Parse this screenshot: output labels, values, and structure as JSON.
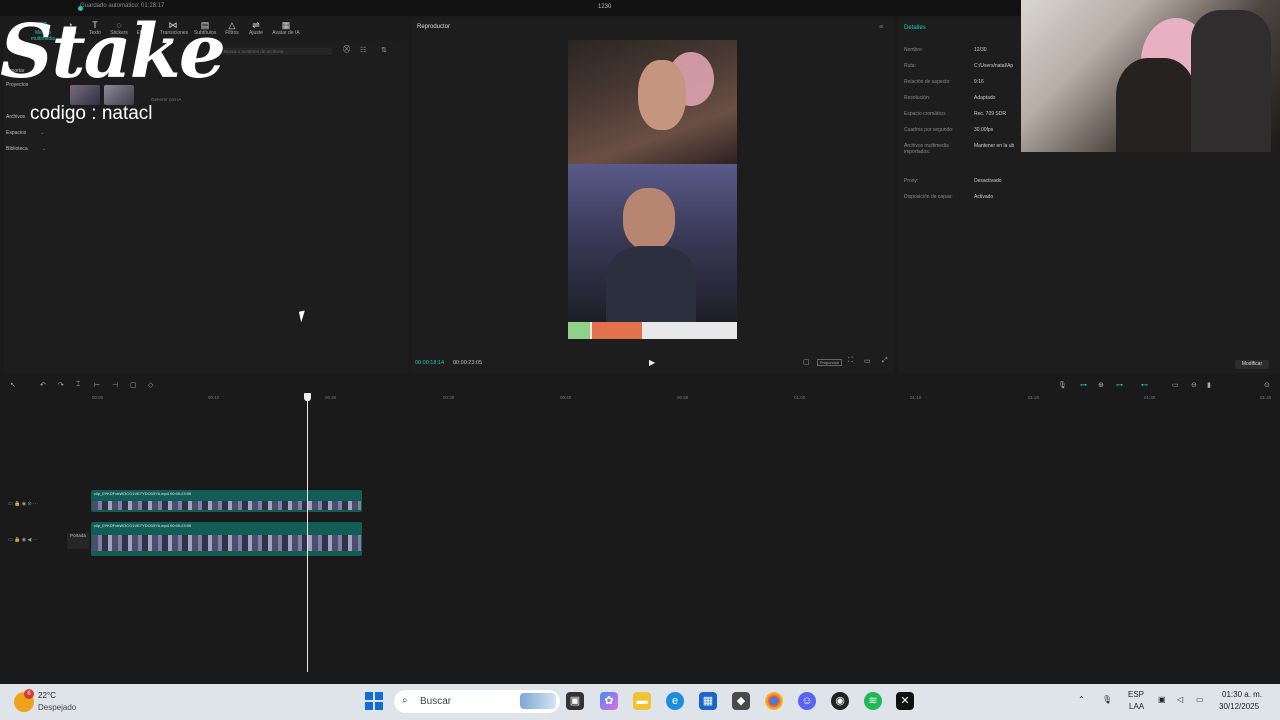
{
  "titlebar": {
    "autosave": "Guardado automático: 01:28:17",
    "project_name": "1230"
  },
  "toolbar": {
    "items": [
      "Medios multimedia",
      "Audio",
      "Texto",
      "Stickers",
      "Efectos",
      "Transiciones",
      "Subtítulos",
      "Filtros",
      "Ajuste",
      "Avatar de IA"
    ]
  },
  "left_panel": {
    "nav": [
      "Importar",
      "Proyectos",
      "Archivos",
      "Espacios",
      "Biblioteca"
    ],
    "search_placeholder": "Busca o nombres de archivos",
    "thumb_caption": "Generar con IA"
  },
  "overlay": {
    "brand": "Stake",
    "code_text": "codigo : natacl"
  },
  "player": {
    "title": "Reproductor",
    "current_time": "00:00:18:14",
    "total_time": "00:00:23:05",
    "ratio_label": "Proporción"
  },
  "details": {
    "title": "Detalles",
    "rows": [
      {
        "label": "Nombre:",
        "value": "12/30"
      },
      {
        "label": "Ruta:",
        "value": "C:/Users/natal/Ap"
      },
      {
        "label": "Relación de aspecto:",
        "value": "9:16"
      },
      {
        "label": "Resolución:",
        "value": "Adaptado"
      },
      {
        "label": "Espacio cromático:",
        "value": "Rec. 709 SDR"
      },
      {
        "label": "Cuadros por segundo:",
        "value": "30.00fps"
      },
      {
        "label": "Archivos multimedia importados:",
        "value": "Mantener en la ub"
      },
      {
        "label": "Proxy:",
        "value": "Desactivado"
      },
      {
        "label": "Disposición de capas:",
        "value": "Activado"
      }
    ],
    "modify_label": "Modificar"
  },
  "timeline": {
    "ruler": [
      "00:00",
      "00:10",
      "00:20",
      "00:30",
      "00:40",
      "00:50",
      "01:00",
      "01:10",
      "01:20",
      "01:30",
      "01:40"
    ],
    "clips": [
      {
        "name": "clip_0YKDFvbWOCG1VE7YDO33Y6.mp4   00:00:23:05"
      },
      {
        "name": "clip_0YKDFvbWOCG1VE7YDO33Y6.mp4   00:00:23:05"
      }
    ],
    "cover_label": "Portada"
  },
  "taskbar": {
    "weather_temp": "22°C",
    "weather_desc": "Despejado",
    "weather_badge": "6",
    "search_placeholder": "Buscar",
    "lang": "ESP",
    "lang2": "LAA",
    "time": "01:30 a. m.",
    "date": "30/12/2025"
  },
  "colors": {
    "accent": "#1fc8b8",
    "clip": "#125d55",
    "panel": "#1d1d1d"
  }
}
